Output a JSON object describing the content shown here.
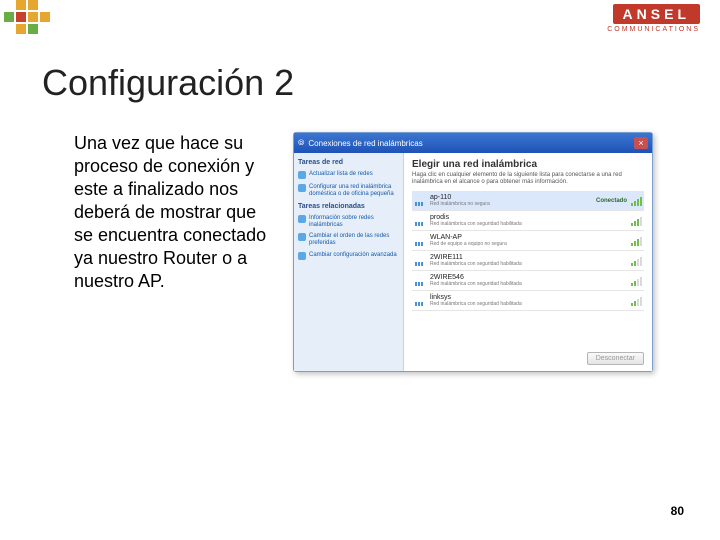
{
  "brand": {
    "name": "ANSEL",
    "subtitle": "COMMUNICATIONS"
  },
  "pixel_colors": [
    "#e7a62f",
    "#e7a62f",
    "#6aad46",
    "#e7a62f",
    "#c7412f",
    "#e7a62f",
    "#6aad46",
    "#e7a62f"
  ],
  "title": "Configuración 2",
  "body": "Una vez que hace su proceso de conexión y este a finalizado nos deberá de mostrar que se encuentra conectado ya nuestro Router o a nuestro AP.",
  "window": {
    "title": "Conexiones de red inalámbricas",
    "sidebar": {
      "group1": "Tareas de red",
      "group2": "Tareas relacionadas",
      "items": [
        "Actualizar lista de redes",
        "Configurar una red inalámbrica doméstica o de oficina pequeña",
        "Información sobre redes inalámbricas",
        "Cambiar el orden de las redes preferidas",
        "Cambiar configuración avanzada"
      ]
    },
    "main": {
      "heading": "Elegir una red inalámbrica",
      "sub": "Haga clic en cualquier elemento de la siguiente lista para conectarse a una red inalámbrica en el alcance o para obtener más información.",
      "connected_label": "Conectado",
      "networks": [
        {
          "name": "ap-110",
          "desc": "Red inalámbrica no segura",
          "status": "Conectado",
          "sig": "hi"
        },
        {
          "name": "prodis",
          "desc": "Red inalámbrica con seguridad habilitada",
          "status": "",
          "sig": "mid"
        },
        {
          "name": "WLAN-AP",
          "desc": "Red de equipo a equipo no segura",
          "status": "",
          "sig": "mid"
        },
        {
          "name": "2WIRE111",
          "desc": "Red inalámbrica con seguridad habilitada",
          "status": "",
          "sig": "low"
        },
        {
          "name": "2WIRE546",
          "desc": "Red inalámbrica con seguridad habilitada",
          "status": "",
          "sig": "low"
        },
        {
          "name": "linksys",
          "desc": "Red inalámbrica con seguridad habilitada",
          "status": "",
          "sig": "low"
        }
      ],
      "button": "Desconectar"
    }
  },
  "page_number": "80"
}
